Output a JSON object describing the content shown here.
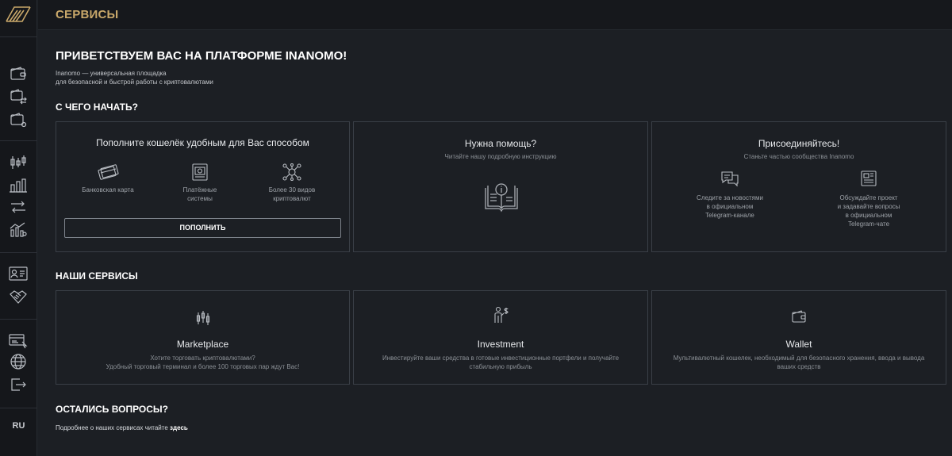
{
  "colors": {
    "accent": "#c9a86a",
    "background": "#1c1f24",
    "sidebar": "#15171b",
    "border": "#3a3f47"
  },
  "header": {
    "title": "СЕРВИСЫ"
  },
  "sidebar": {
    "groups": [
      [
        "wallet-icon",
        "wallet-transfer-icon",
        "wallet-settings-icon"
      ],
      [
        "candlestick-icon",
        "bar-chart-icon",
        "exchange-arrows-icon",
        "analytics-icon"
      ],
      [
        "id-card-icon",
        "handshake-icon"
      ],
      [
        "card-click-icon",
        "globe-icon",
        "logout-icon"
      ]
    ],
    "language": "RU"
  },
  "welcome": {
    "title": "ПРИВЕТСТВУЕМ ВАС НА ПЛАТФОРМЕ INANOMO!",
    "subtitle_line1": "Inanomo — универсальная площадка",
    "subtitle_line2": "для безопасной и быстрой работы с криптовалютами"
  },
  "start": {
    "title": "С ЧЕГО НАЧАТЬ?",
    "topup": {
      "title": "Пополните кошелёк удобным для Вас способом",
      "methods": [
        {
          "icon": "bank-card-icon",
          "line1": "Банковская карта",
          "line2": ""
        },
        {
          "icon": "payment-system-icon",
          "line1": "Платёжные",
          "line2": "системы"
        },
        {
          "icon": "crypto-network-icon",
          "line1": "Более 30 видов",
          "line2": "криптовалют"
        }
      ],
      "button": "ПОПОЛНИТЬ"
    },
    "help": {
      "title": "Нужна помощь?",
      "subtitle": "Читайте нашу подробную инструкцию",
      "icon": "instruction-book-icon"
    },
    "join": {
      "title": "Присоединяйтесь!",
      "subtitle": "Станьте частью сообщества Inanomo",
      "items": [
        {
          "icon": "chat-bubbles-icon",
          "lines": [
            "Следите за новостями",
            "в официальном",
            "Telegram-канале"
          ]
        },
        {
          "icon": "news-icon",
          "lines": [
            "Обсуждайте проект",
            "и задавайте вопросы",
            "в официальном",
            "Telegram-чате"
          ]
        }
      ]
    }
  },
  "services": {
    "title": "НАШИ СЕРВИСЫ",
    "items": [
      {
        "icon": "candlestick-icon",
        "name": "Marketplace",
        "desc_line1": "Хотите торговать криптовалютами?",
        "desc_line2": "Удобный торговый терминал и более 100 торговых пар ждут Вас!"
      },
      {
        "icon": "investor-icon",
        "name": "Investment",
        "desc_line1": "Инвестируйте ваши средства в готовые инвестиционные портфели и получайте",
        "desc_line2": "стабильную прибыль"
      },
      {
        "icon": "wallet-icon",
        "name": "Wallet",
        "desc_line1": "Мультивалютный кошелек, необходимый для безопасного хранения, ввода и вывода",
        "desc_line2": "ваших средств"
      }
    ]
  },
  "questions": {
    "title": "ОСТАЛИСЬ ВОПРОСЫ?",
    "text": "Подробнее о наших сервисах читайте",
    "link": "здесь"
  }
}
